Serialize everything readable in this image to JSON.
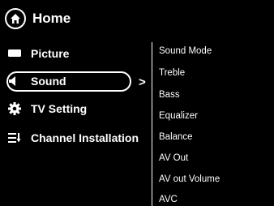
{
  "header": {
    "title": "Home",
    "icon": "home-icon"
  },
  "main_menu": {
    "items": [
      {
        "label": "Picture",
        "icon": "picture-icon"
      },
      {
        "label": "Sound",
        "icon": "speaker-icon",
        "selected": true
      },
      {
        "label": "TV Setting",
        "icon": "gear-icon"
      },
      {
        "label": "Channel Installation",
        "icon": "channel-list-icon"
      }
    ],
    "expand_indicator": ">"
  },
  "submenu": {
    "items": [
      "Sound Mode",
      "Treble",
      "Bass",
      "Equalizer",
      "Balance",
      "AV Out",
      "AV out Volume",
      "AVC"
    ]
  }
}
